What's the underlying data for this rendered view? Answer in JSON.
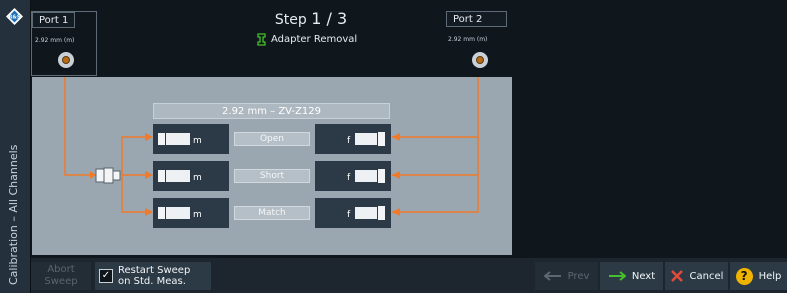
{
  "sidebar": {
    "title": "Calibration – All Channels"
  },
  "ports": [
    {
      "label": "Port 1",
      "size": "2.92 mm (m)"
    },
    {
      "label": "Port 2",
      "size": "2.92 mm (m)"
    }
  ],
  "step": {
    "prefix": "Step ",
    "current": "1 / 3",
    "subtitle": "Adapter Removal"
  },
  "kit": {
    "title": "2.92 mm  – ZV-Z129"
  },
  "standards": [
    {
      "name": "Open",
      "left_gender": "m",
      "right_gender": "f"
    },
    {
      "name": "Short",
      "left_gender": "m",
      "right_gender": "f"
    },
    {
      "name": "Match",
      "left_gender": "m",
      "right_gender": "f"
    }
  ],
  "bottom": {
    "abort_line1": "Abort",
    "abort_line2": "Sweep",
    "restart_line1": "Restart Sweep",
    "restart_line2": "on Std. Meas.",
    "restart_checked": true,
    "prev": "Prev",
    "next": "Next",
    "cancel": "Cancel",
    "help": "Help"
  },
  "colors": {
    "accent_orange": "#f07a2a",
    "next_green": "#45c02b",
    "cancel_red": "#e24a3a",
    "help_yellow": "#f0b400"
  }
}
